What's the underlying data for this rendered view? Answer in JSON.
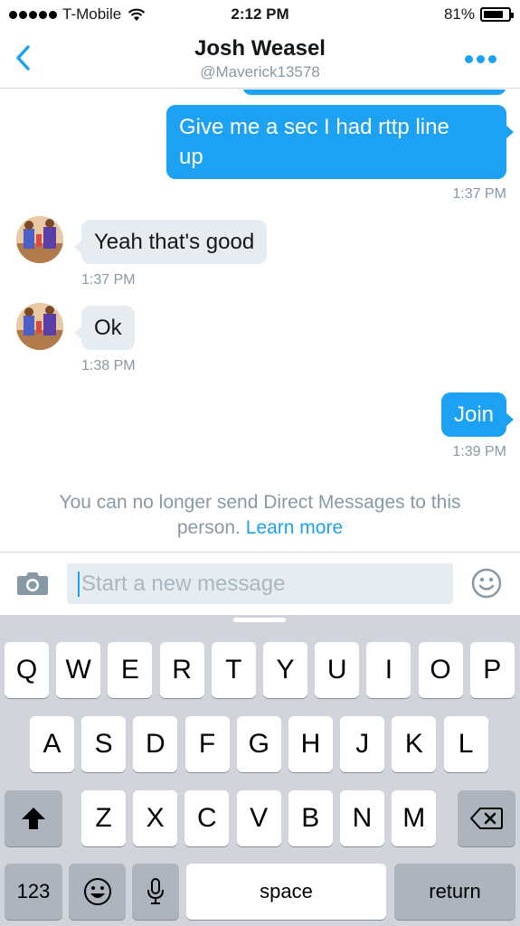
{
  "status_bar": {
    "carrier": "T-Mobile",
    "time": "2:12 PM",
    "battery": "81%",
    "battery_level": 0.81
  },
  "header": {
    "title": "Josh Weasel",
    "handle": "@Maverick13578"
  },
  "messages": [
    {
      "from": "me",
      "text": "Give me a sec I had rttp line up",
      "line1": "Give me a sec I had rttp line",
      "line2": "up",
      "time": "1:37 PM"
    },
    {
      "from": "them",
      "text": "Yeah that's good",
      "time": "1:37 PM"
    },
    {
      "from": "them",
      "text": "Ok",
      "time": "1:38 PM"
    },
    {
      "from": "me",
      "text": "Join",
      "time": "1:39 PM"
    }
  ],
  "notice": {
    "text": "You can no longer send Direct Messages to this person.",
    "link": "Learn more"
  },
  "composer": {
    "placeholder": "Start a new message"
  },
  "keyboard": {
    "row1": [
      "Q",
      "W",
      "E",
      "R",
      "T",
      "Y",
      "U",
      "I",
      "O",
      "P"
    ],
    "row2": [
      "A",
      "S",
      "D",
      "F",
      "G",
      "H",
      "J",
      "K",
      "L"
    ],
    "row3": [
      "Z",
      "X",
      "C",
      "V",
      "B",
      "N",
      "M"
    ],
    "numbers_label": "123",
    "space_label": "space",
    "return_label": "return"
  },
  "colors": {
    "accent": "#1da1f2",
    "received_bubble": "#e6ecf0",
    "timestamp": "#8899a6",
    "keyboard_bg": "#d1d5db"
  }
}
